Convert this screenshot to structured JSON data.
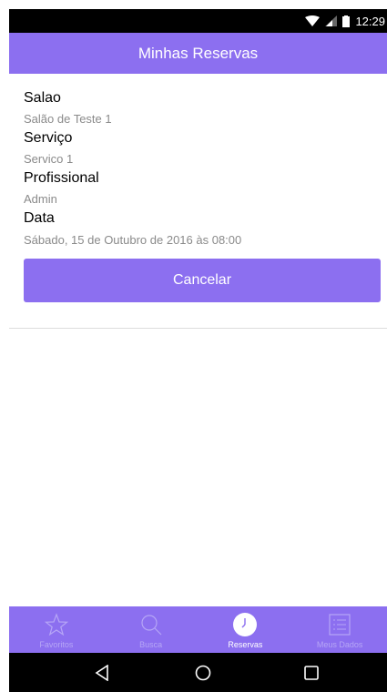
{
  "status_bar": {
    "time": "12:29"
  },
  "app_bar": {
    "title": "Minhas Reservas"
  },
  "reservation": {
    "salon_label": "Salao",
    "salon_value": "Salão de Teste 1",
    "service_label": "Serviço",
    "service_value": "Servico 1",
    "professional_label": "Profissional",
    "professional_value": "Admin",
    "date_label": "Data",
    "date_value": "Sábado, 15 de Outubro de 2016 às 08:00",
    "cancel_label": "Cancelar"
  },
  "tabs": [
    {
      "label": "Favoritos",
      "icon": "star-icon",
      "active": false
    },
    {
      "label": "Busca",
      "icon": "search-icon",
      "active": false
    },
    {
      "label": "Reservas",
      "icon": "clock-icon",
      "active": true
    },
    {
      "label": "Meus Dados",
      "icon": "list-icon",
      "active": false
    }
  ],
  "navigation": {
    "icons": [
      "back-icon",
      "home-icon",
      "recents-icon"
    ]
  },
  "colors": {
    "accent": "#8c6ff0",
    "status_bar": "#000000",
    "divider": "#dcdcdc"
  }
}
